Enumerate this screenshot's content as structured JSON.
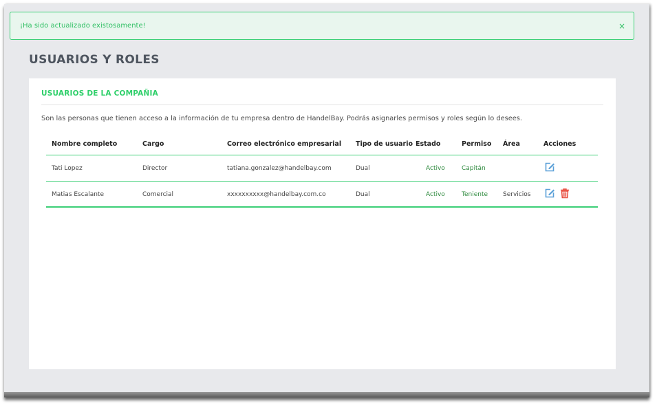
{
  "alert": {
    "message": "¡Ha sido actualizado existosamente!",
    "close": "×"
  },
  "page": {
    "title": "USUARIOS Y ROLES"
  },
  "card": {
    "title": "USUARIOS DE LA COMPAÑIA",
    "description": "Son las personas que tienen acceso a la información de tu empresa dentro de HandelBay. Podrás asignarles permisos y roles según lo desees."
  },
  "table": {
    "headers": [
      "Nombre completo",
      "Cargo",
      "Correo electrónico empresarial",
      "Tipo de usuario",
      "Estado",
      "Permiso",
      "Área",
      "Acciones"
    ],
    "rows": [
      {
        "name": "Tati Lopez",
        "role": "Director",
        "email": "tatiana.gonzalez@handelbay.com",
        "type": "Dual",
        "status": "Activo",
        "permission": "Capitán",
        "area": "",
        "actions": [
          "edit-icon"
        ]
      },
      {
        "name": "Matias Escalante",
        "role": "Comercial",
        "email": "xxxxxxxxxx@handelbay.com.co",
        "type": "Dual",
        "status": "Activo",
        "permission": "Teniente",
        "area": "Servicios",
        "actions": [
          "edit-icon",
          "trash-icon"
        ]
      }
    ]
  },
  "colors": {
    "accent": "#3ccf76",
    "alert_bg": "#e9f6ee",
    "edit_icon": "#5aa0d8",
    "delete_icon": "#e84c3d",
    "status_text": "#2e8a3e"
  }
}
